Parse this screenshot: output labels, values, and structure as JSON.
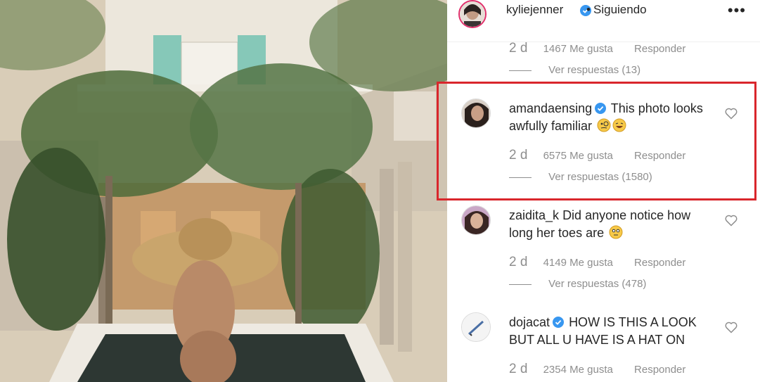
{
  "header": {
    "username": "kyliejenner",
    "separator": "•",
    "follow_status": "Siguiendo",
    "more_icon": "•••"
  },
  "top_comment": {
    "time": "2 d",
    "likes": "1467 Me gusta",
    "reply_label": "Responder",
    "view_replies": "Ver respuestas (13)"
  },
  "comments": [
    {
      "username": "amandaensing",
      "verified": true,
      "text": "This photo looks awfully familiar",
      "time": "2 d",
      "likes": "6575 Me gusta",
      "reply_label": "Responder",
      "view_replies": "Ver respuestas (1580)"
    },
    {
      "username": "zaidita_k",
      "verified": false,
      "text": "Did anyone notice how long her toes are",
      "time": "2 d",
      "likes": "4149 Me gusta",
      "reply_label": "Responder",
      "view_replies": "Ver respuestas (478)"
    },
    {
      "username": "dojacat",
      "verified": true,
      "text": "HOW IS THIS A LOOK BUT ALL U HAVE IS A HAT ON",
      "time": "2 d",
      "likes": "2354 Me gusta",
      "reply_label": "Responder"
    }
  ],
  "colors": {
    "verified_blue": "#3897f0",
    "highlight_red": "#d9262c",
    "muted_text": "#8e8e8e"
  }
}
